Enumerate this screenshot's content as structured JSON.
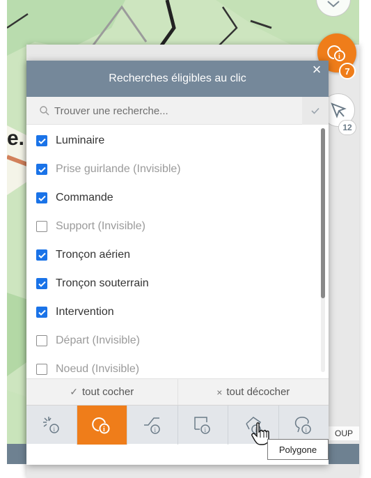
{
  "panel": {
    "title": "Recherches éligibles au clic",
    "close_label": "×"
  },
  "search": {
    "placeholder": "Trouver une recherche..."
  },
  "items": [
    {
      "label": "Luminaire",
      "checked": true,
      "invisible": false
    },
    {
      "label": "Prise guirlande (Invisible)",
      "checked": true,
      "invisible": true
    },
    {
      "label": "Commande",
      "checked": true,
      "invisible": false
    },
    {
      "label": "Support (Invisible)",
      "checked": false,
      "invisible": true
    },
    {
      "label": "Tronçon aérien",
      "checked": true,
      "invisible": false
    },
    {
      "label": "Tronçon souterrain",
      "checked": true,
      "invisible": false
    },
    {
      "label": "Intervention",
      "checked": true,
      "invisible": false
    },
    {
      "label": "Départ (Invisible)",
      "checked": false,
      "invisible": true
    },
    {
      "label": "Noeud (Invisible)",
      "checked": false,
      "invisible": true
    }
  ],
  "actions": {
    "check_all": "tout cocher",
    "uncheck_all": "tout décocher"
  },
  "toolbar": {
    "tools": [
      {
        "icon": "click-info-icon",
        "active": false
      },
      {
        "icon": "circle-info-icon",
        "active": true
      },
      {
        "icon": "line-info-icon",
        "active": false
      },
      {
        "icon": "rectangle-info-icon",
        "active": false
      },
      {
        "icon": "polygon-info-icon",
        "active": false
      },
      {
        "icon": "lasso-info-icon",
        "active": false
      }
    ]
  },
  "tooltip": {
    "text": "Polygone"
  },
  "map_buttons": {
    "info_badge": "7",
    "select_badge": "12"
  },
  "map_tag": "OUP",
  "map_text": "e.",
  "colors": {
    "header": "#75889a",
    "accent": "#ef7d1a",
    "checkbox": "#1a73e8",
    "footer": "#6e8191"
  }
}
